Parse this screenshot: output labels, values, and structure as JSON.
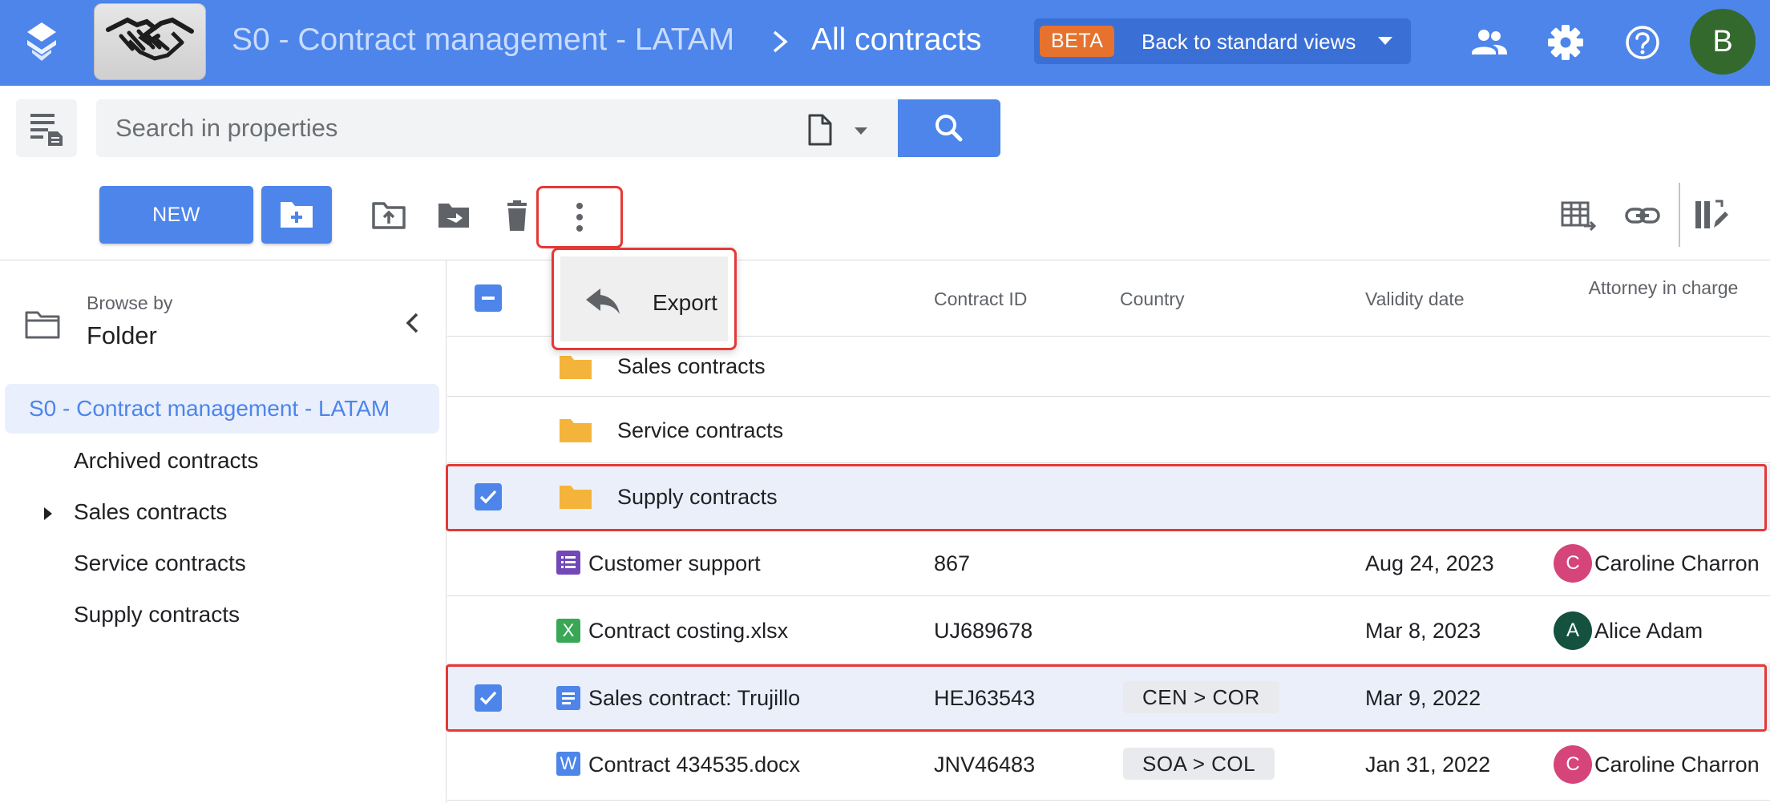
{
  "topbar": {
    "breadcrumb_root": "S0 - Contract management - LATAM",
    "breadcrumb_current": "All contracts",
    "beta_badge": "BETA",
    "beta_link": "Back to standard views",
    "user_initial": "B",
    "colors": {
      "bar": "#4d85ea",
      "beta_badge": "#e6722e",
      "avatar": "#33692d"
    }
  },
  "search": {
    "placeholder": "Search in properties"
  },
  "toolbar": {
    "new_label": "NEW"
  },
  "menu": {
    "export_label": "Export"
  },
  "sidebar": {
    "browse_by": "Browse by",
    "browse_mode": "Folder",
    "root": "S0 - Contract management - LATAM",
    "items": [
      {
        "label": "Archived contracts",
        "expandable": false
      },
      {
        "label": "Sales contracts",
        "expandable": true
      },
      {
        "label": "Service contracts",
        "expandable": false
      },
      {
        "label": "Supply contracts",
        "expandable": false
      }
    ]
  },
  "table": {
    "columns": {
      "contract_id": "Contract ID",
      "country": "Country",
      "validity": "Validity date",
      "attorney": "Attorney in charge"
    },
    "rows": [
      {
        "type": "folder",
        "name": "Sales contracts",
        "selected": false
      },
      {
        "type": "folder",
        "name": "Service contracts",
        "selected": false
      },
      {
        "type": "folder",
        "name": "Supply contracts",
        "selected": true
      },
      {
        "type": "form",
        "name": "Customer support",
        "contract_id": "867",
        "country": "",
        "validity": "Aug 24, 2023",
        "attorney": "Caroline Charron",
        "attorney_initial": "C",
        "selected": false
      },
      {
        "type": "sheet",
        "name": "Contract costing.xlsx",
        "contract_id": "UJ689678",
        "country": "",
        "validity": "Mar 8, 2023",
        "attorney": "Alice Adam",
        "attorney_initial": "A",
        "selected": false
      },
      {
        "type": "doc",
        "name": "Sales contract: Trujillo",
        "contract_id": "HEJ63543",
        "country": "CEN  >  COR",
        "validity": "Mar 9, 2022",
        "attorney": "",
        "selected": true
      },
      {
        "type": "word",
        "name": "Contract 434535.docx",
        "contract_id": "JNV46483",
        "country": "SOA  >  COL",
        "validity": "Jan 31, 2022",
        "attorney": "Caroline Charron",
        "attorney_initial": "C",
        "selected": false
      }
    ]
  }
}
